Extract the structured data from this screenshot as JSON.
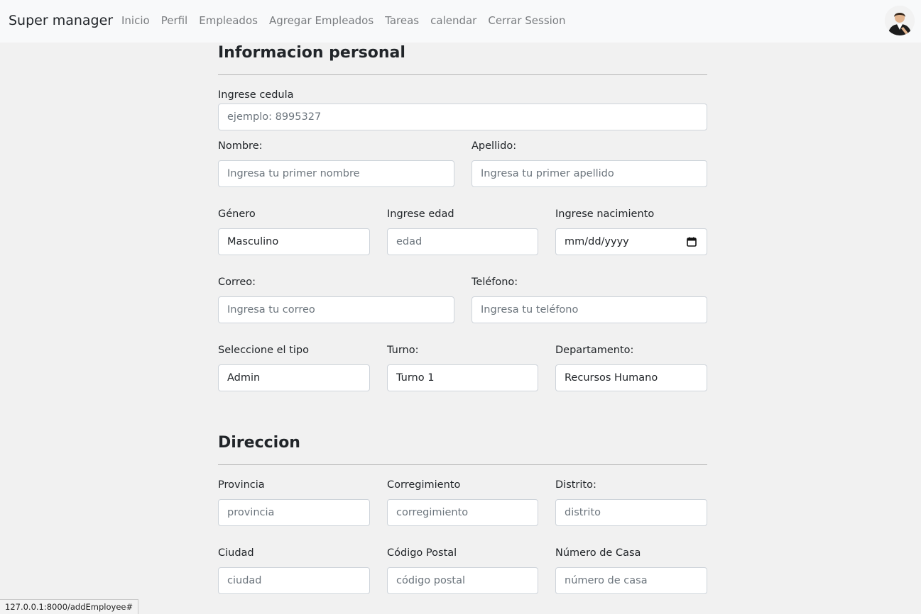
{
  "navbar": {
    "brand": "Super manager",
    "links": [
      "Inicio",
      "Perfil",
      "Empleados",
      "Agregar Empleados",
      "Tareas",
      "calendar",
      "Cerrar Session"
    ]
  },
  "personal": {
    "title": "Informacion personal",
    "cedula": {
      "label": "Ingrese cedula",
      "placeholder": "ejemplo: 8995327"
    },
    "nombre": {
      "label": "Nombre:",
      "placeholder": "Ingresa tu primer nombre"
    },
    "apellido": {
      "label": "Apellido:",
      "placeholder": "Ingresa tu primer apellido"
    },
    "genero": {
      "label": "Género",
      "value": "Masculino"
    },
    "edad": {
      "label": "Ingrese edad",
      "placeholder": "edad"
    },
    "nacimiento": {
      "label": "Ingrese nacimiento",
      "value": "mm/dd/yyyy"
    },
    "correo": {
      "label": "Correo:",
      "placeholder": "Ingresa tu correo"
    },
    "telefono": {
      "label": "Teléfono:",
      "placeholder": "Ingresa tu teléfono"
    },
    "tipo": {
      "label": "Seleccione el tipo",
      "value": "Admin"
    },
    "turno": {
      "label": "Turno:",
      "value": "Turno 1"
    },
    "departamento": {
      "label": "Departamento:",
      "value": "Recursos Humano"
    }
  },
  "direccion": {
    "title": "Direccion",
    "provincia": {
      "label": "Provincia",
      "placeholder": "provincia"
    },
    "corregimiento": {
      "label": "Corregimiento",
      "placeholder": "corregimiento"
    },
    "distrito": {
      "label": "Distrito:",
      "placeholder": "distrito"
    },
    "ciudad": {
      "label": "Ciudad",
      "placeholder": "ciudad"
    },
    "codigo_postal": {
      "label": "Código Postal",
      "placeholder": "código postal"
    },
    "numero_casa": {
      "label": "Número de Casa",
      "placeholder": "número de casa"
    }
  },
  "status_bar": {
    "url": "127.0.0.1:8000/addEmployee#"
  },
  "colors": {
    "navbar_bg": "#f8f9fa",
    "page_bg": "#f1f1f1",
    "placeholder": "#6c757d",
    "border": "#ced4da"
  }
}
